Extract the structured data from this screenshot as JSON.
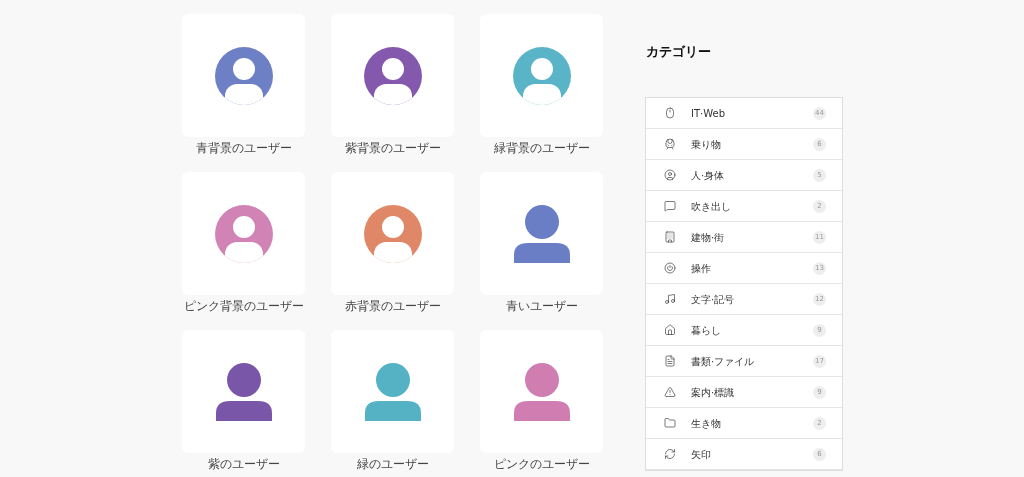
{
  "icons": [
    {
      "label": "青背景のユーザー",
      "kind": "circle",
      "color": "#6d80c6"
    },
    {
      "label": "紫背景のユーザー",
      "kind": "circle",
      "color": "#8458ac"
    },
    {
      "label": "緑背景のユーザー",
      "kind": "circle",
      "color": "#5ab4c8"
    },
    {
      "label": "ピンク背景のユーザー",
      "kind": "circle",
      "color": "#d283b6"
    },
    {
      "label": "赤背景のユーザー",
      "kind": "circle",
      "color": "#df8766"
    },
    {
      "label": "青いユーザー",
      "kind": "plain",
      "color": "#6a7ec6"
    },
    {
      "label": "紫のユーザー",
      "kind": "plain",
      "color": "#7a56a8"
    },
    {
      "label": "緑のユーザー",
      "kind": "plain",
      "color": "#54b2c4"
    },
    {
      "label": "ピンクのユーザー",
      "kind": "plain",
      "color": "#d07eb2"
    }
  ],
  "sidebar": {
    "title": "カテゴリー",
    "categories": [
      {
        "label": "IT·Web",
        "count": "44"
      },
      {
        "label": "乗り物",
        "count": "6"
      },
      {
        "label": "人·身体",
        "count": "5"
      },
      {
        "label": "吹き出し",
        "count": "2"
      },
      {
        "label": "建物·街",
        "count": "11"
      },
      {
        "label": "操作",
        "count": "13"
      },
      {
        "label": "文字·記号",
        "count": "12"
      },
      {
        "label": "暮らし",
        "count": "9"
      },
      {
        "label": "書類·ファイル",
        "count": "17"
      },
      {
        "label": "案内·標識",
        "count": "9"
      },
      {
        "label": "生き物",
        "count": "2"
      },
      {
        "label": "矢印",
        "count": "6"
      }
    ]
  }
}
